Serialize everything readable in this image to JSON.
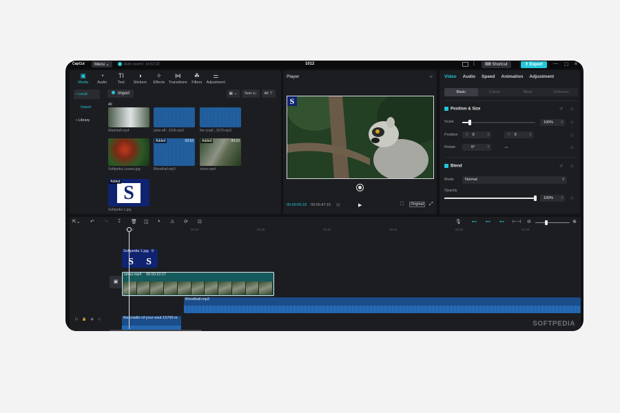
{
  "titlebar": {
    "app_name": "CapCut",
    "menu_label": "Menu",
    "autosave": "Auto saved: 14:53:32",
    "project_title": "1012",
    "shortcut_label": "Shortcut",
    "export_label": "Export"
  },
  "media_panel": {
    "tabs": [
      {
        "label": "Media",
        "icon": "media-icon"
      },
      {
        "label": "Audio",
        "icon": "audio-icon"
      },
      {
        "label": "Text",
        "icon": "text-icon"
      },
      {
        "label": "Stickers",
        "icon": "sticker-icon"
      },
      {
        "label": "Effects",
        "icon": "effects-icon"
      },
      {
        "label": "Transitions",
        "icon": "transitions-icon"
      },
      {
        "label": "Filters",
        "icon": "filters-icon"
      },
      {
        "label": "Adjustment",
        "icon": "adjustment-icon"
      }
    ],
    "nav": [
      "• Local",
      "Import",
      "• Library"
    ],
    "import_label": "Import",
    "sort_label": "Sort",
    "all_label": "All",
    "group_label": "All",
    "items": [
      {
        "name": "Waterfall.mp4",
        "type": "video"
      },
      {
        "name": "pixie-eff...3106.mp3",
        "type": "audio"
      },
      {
        "name": "the-cradl...1570.mp3",
        "type": "audio"
      },
      {
        "name": "Softpedia Leaves.jpg",
        "type": "image"
      },
      {
        "name": "Bloodhall.mp3",
        "type": "audio",
        "badge": "Added",
        "duration": "03:53"
      },
      {
        "name": "simur.mp4",
        "type": "video",
        "badge": "Added",
        "duration": "00:23"
      },
      {
        "name": "Softpedia 1.jpg",
        "type": "image",
        "badge": "Added"
      }
    ]
  },
  "player": {
    "title": "Player",
    "current_time": "00:00:00:18",
    "total_time": "00:05:47:15",
    "original_label": "Original",
    "overlay_letter": "S"
  },
  "properties": {
    "tabs": [
      "Video",
      "Audio",
      "Speed",
      "Animation",
      "Adjustment"
    ],
    "subtabs": [
      "Basic",
      "Cutout",
      "Mask",
      "Enhance"
    ],
    "position_size": {
      "title": "Position & Size",
      "scale_label": "Scale",
      "scale_value": "100%",
      "scale_fraction": 0.1,
      "position_label": "Position",
      "x_prefix": "X",
      "x_value": "0",
      "y_prefix": "Y",
      "y_value": "0",
      "rotate_label": "Rotate",
      "rotate_value": "0°"
    },
    "blend": {
      "title": "Blend",
      "mode_label": "Mode",
      "mode_value": "Normal",
      "opacity_label": "Opacity",
      "opacity_value": "100%",
      "opacity_fraction": 1.0
    }
  },
  "timeline": {
    "ruler": [
      "00:00",
      "00:10",
      "00:20",
      "00:30",
      "00:40",
      "00:50",
      "01:00"
    ],
    "clips": {
      "image_clip": {
        "label": "Softpedia 1.jpg",
        "extra": "0"
      },
      "video_clip": {
        "label": "simur.mp4",
        "duration": "00:00:22:27"
      },
      "audio_clip1": {
        "label": "Bloodhall.mp3"
      },
      "audio_clip2": {
        "label": "the-cradle-of-your-soul-15700.m"
      }
    },
    "watermark": "SOFTPEDIA"
  },
  "colors": {
    "accent": "#23c6d9",
    "panel": "#1c1d21",
    "background": "#111215"
  }
}
